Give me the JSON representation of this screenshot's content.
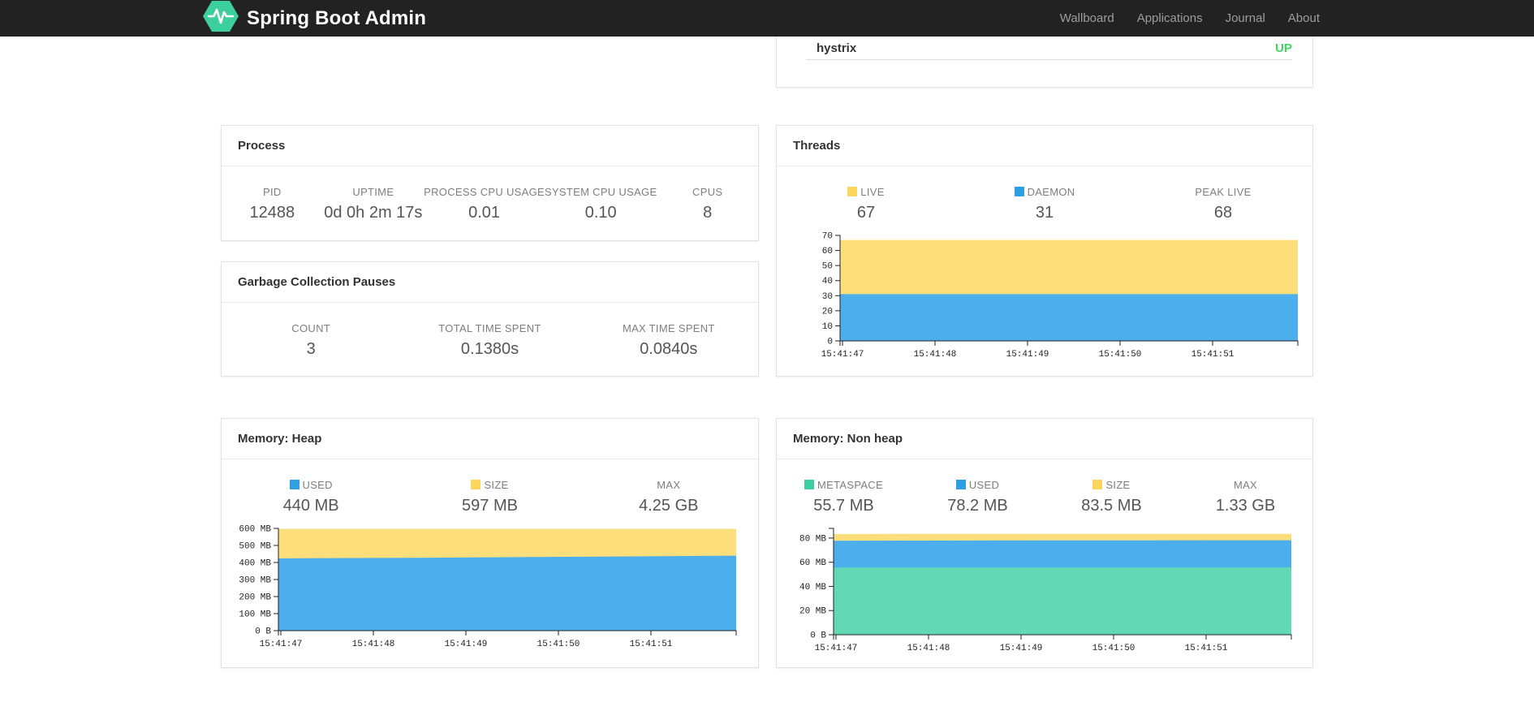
{
  "navbar": {
    "brand": "Spring Boot Admin",
    "items": [
      {
        "label": "Wallboard"
      },
      {
        "label": "Applications"
      },
      {
        "label": "Journal"
      },
      {
        "label": "About"
      }
    ]
  },
  "colors": {
    "brand_green": "#3ecf9e",
    "status_up": "#40d565",
    "area_yellow": "#fcde7b",
    "area_blue": "#4daeec",
    "area_green": "#62d9b4"
  },
  "health_card": {
    "item_label": "hystrix",
    "status": "UP",
    "status_color": "#40d565"
  },
  "process_card": {
    "title": "Process",
    "stats": [
      {
        "label": "PID",
        "value": "12488"
      },
      {
        "label": "UPTIME",
        "value": "0d 0h 2m 17s"
      },
      {
        "label": "PROCESS CPU USAGE",
        "value": "0.01"
      },
      {
        "label": "SYSTEM CPU USAGE",
        "value": "0.10"
      },
      {
        "label": "CPUS",
        "value": "8"
      }
    ]
  },
  "gc_card": {
    "title": "Garbage Collection Pauses",
    "stats": [
      {
        "label": "COUNT",
        "value": "3"
      },
      {
        "label": "TOTAL TIME SPENT",
        "value": "0.1380s"
      },
      {
        "label": "MAX TIME SPENT",
        "value": "0.0840s"
      }
    ]
  },
  "threads_card": {
    "title": "Threads",
    "stats": [
      {
        "label": "LIVE",
        "value": "67",
        "swatch": "#fcd65c"
      },
      {
        "label": "DAEMON",
        "value": "31",
        "swatch": "#2e9fe3"
      },
      {
        "label": "PEAK LIVE",
        "value": "68",
        "swatch": ""
      }
    ]
  },
  "heap_card": {
    "title": "Memory: Heap",
    "stats": [
      {
        "label": "USED",
        "value": "440 MB",
        "swatch": "#2e9fe3"
      },
      {
        "label": "SIZE",
        "value": "597 MB",
        "swatch": "#fcd65c"
      },
      {
        "label": "MAX",
        "value": "4.25 GB",
        "swatch": ""
      }
    ]
  },
  "nonheap_card": {
    "title": "Memory: Non heap",
    "stats": [
      {
        "label": "METASPACE",
        "value": "55.7 MB",
        "swatch": "#3bcfa1"
      },
      {
        "label": "USED",
        "value": "78.2 MB",
        "swatch": "#2e9fe3"
      },
      {
        "label": "SIZE",
        "value": "83.5 MB",
        "swatch": "#fcd65c"
      },
      {
        "label": "MAX",
        "value": "1.33 GB",
        "swatch": ""
      }
    ]
  },
  "chart_data": [
    {
      "id": "threads",
      "type": "area",
      "title": "Threads",
      "stacked": true,
      "grid": false,
      "legend_position": "top",
      "x_ticks": [
        "15:41:47",
        "15:41:48",
        "15:41:49",
        "15:41:50",
        "15:41:51"
      ],
      "ylim": [
        0,
        70
      ],
      "ymax": 70,
      "y_ticks": [
        {
          "value": 0,
          "label": "0"
        },
        {
          "value": 10,
          "label": "10"
        },
        {
          "value": 20,
          "label": "20"
        },
        {
          "value": 30,
          "label": "30"
        },
        {
          "value": 40,
          "label": "40"
        },
        {
          "value": 50,
          "label": "50"
        },
        {
          "value": 60,
          "label": "60"
        },
        {
          "value": 70,
          "label": "70"
        }
      ],
      "series": [
        {
          "name": "LIVE",
          "color": "#fcde7b",
          "values": [
            67,
            67,
            67,
            67,
            67,
            67,
            67
          ]
        },
        {
          "name": "DAEMON",
          "color": "#4daeec",
          "values": [
            31,
            31,
            31,
            31,
            31,
            31,
            31
          ]
        }
      ]
    },
    {
      "id": "heap",
      "type": "area",
      "title": "Memory: Heap",
      "stacked": true,
      "grid": false,
      "legend_position": "top",
      "x_ticks": [
        "15:41:47",
        "15:41:48",
        "15:41:49",
        "15:41:50",
        "15:41:51"
      ],
      "ylim": [
        0,
        600
      ],
      "ymax": 600,
      "unit": "MB",
      "y_ticks": [
        {
          "value": 0,
          "label": "0 B"
        },
        {
          "value": 100,
          "label": "100 MB"
        },
        {
          "value": 200,
          "label": "200 MB"
        },
        {
          "value": 300,
          "label": "300 MB"
        },
        {
          "value": 400,
          "label": "400 MB"
        },
        {
          "value": 500,
          "label": "500 MB"
        },
        {
          "value": 600,
          "label": "600 MB"
        }
      ],
      "series": [
        {
          "name": "SIZE",
          "color": "#fcde7b",
          "values": [
            597,
            597,
            597,
            597,
            597,
            597,
            597
          ]
        },
        {
          "name": "USED",
          "color": "#4daeec",
          "values": [
            424,
            426,
            428,
            431,
            434,
            437,
            440
          ]
        }
      ]
    },
    {
      "id": "nonheap",
      "type": "area",
      "title": "Memory: Non heap",
      "stacked": true,
      "grid": false,
      "legend_position": "top",
      "x_ticks": [
        "15:41:47",
        "15:41:48",
        "15:41:49",
        "15:41:50",
        "15:41:51"
      ],
      "ylim": [
        0,
        88
      ],
      "ymax": 88,
      "unit": "MB",
      "y_ticks": [
        {
          "value": 0,
          "label": "0 B"
        },
        {
          "value": 20,
          "label": "20 MB"
        },
        {
          "value": 40,
          "label": "40 MB"
        },
        {
          "value": 60,
          "label": "60 MB"
        },
        {
          "value": 80,
          "label": "80 MB"
        }
      ],
      "series": [
        {
          "name": "SIZE",
          "color": "#fcde7b",
          "values": [
            83.3,
            83.4,
            83.4,
            83.5,
            83.5,
            83.5,
            83.5
          ]
        },
        {
          "name": "USED",
          "color": "#4daeec",
          "values": [
            77.8,
            77.9,
            78.0,
            78.1,
            78.1,
            78.2,
            78.2
          ]
        },
        {
          "name": "METASPACE",
          "color": "#62d9b4",
          "values": [
            55.6,
            55.6,
            55.7,
            55.7,
            55.7,
            55.7,
            55.7
          ]
        }
      ]
    }
  ]
}
